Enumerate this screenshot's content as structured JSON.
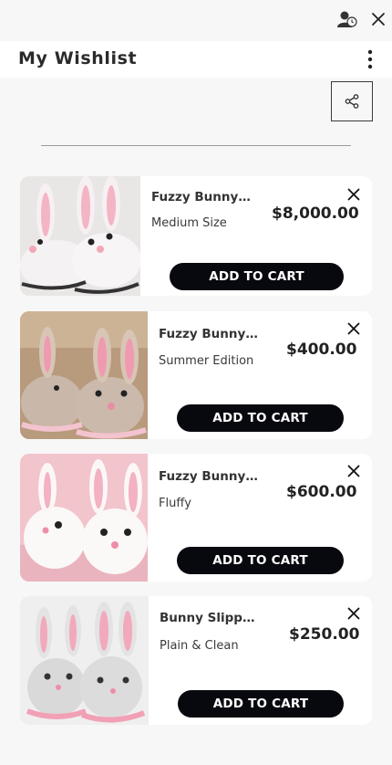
{
  "header": {
    "title": "My Wishlist"
  },
  "items": [
    {
      "name": "Fuzzy Bunny Sl...",
      "variant": "Medium Size",
      "price": "$8,000.00",
      "cta": "ADD TO CART"
    },
    {
      "name": "Fuzzy Bunny Sli...",
      "variant": "Summer Edition",
      "price": "$400.00",
      "cta": "ADD TO CART"
    },
    {
      "name": "Fuzzy Bunny Sli...",
      "variant": "Fluffy",
      "price": "$600.00",
      "cta": "ADD TO CART"
    },
    {
      "name": "Bunny Slippers",
      "variant": "Plain & Clean",
      "price": "$250.00",
      "cta": "ADD TO CART"
    }
  ],
  "icons": {
    "top_left": "user-status-icon",
    "top_right": "close-icon",
    "menu": "kebab-menu-icon",
    "share": "share-icon",
    "remove": "close-icon",
    "product_image": "bunny-slippers-image"
  },
  "colors": {
    "button": "#08080f",
    "card": "#ffffff",
    "background": "#f7f7f7"
  }
}
